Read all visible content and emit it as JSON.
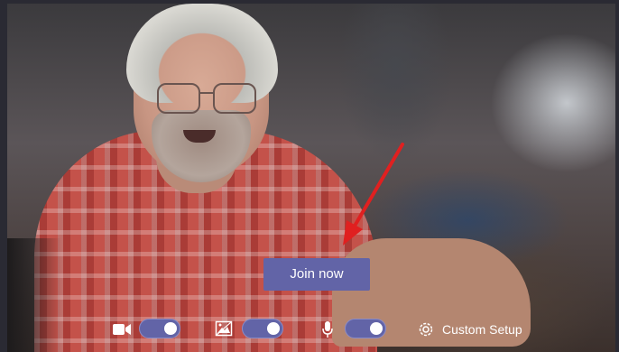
{
  "join": {
    "label": "Join now"
  },
  "controls": {
    "camera_on": true,
    "background_blur_on": true,
    "mic_on": true,
    "custom_setup_label": "Custom Setup"
  },
  "colors": {
    "accent": "#6264a7",
    "arrow": "#e02020"
  },
  "icons": [
    "camera-icon",
    "background-effects-icon",
    "microphone-icon",
    "gear-icon"
  ]
}
